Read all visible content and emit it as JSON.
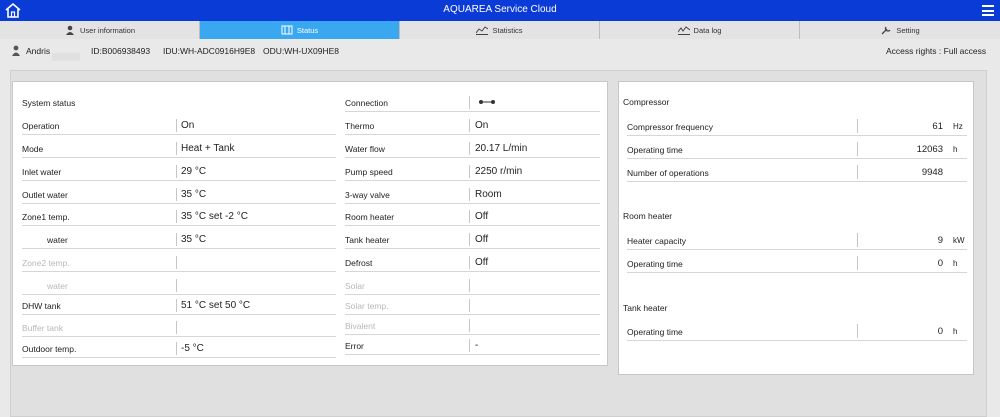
{
  "app": {
    "title": "AQUAREA Service Cloud"
  },
  "tabs": [
    {
      "label": "User information",
      "icon": "user-icon"
    },
    {
      "label": "Status",
      "icon": "status-icon"
    },
    {
      "label": "Statistics",
      "icon": "statistics-icon"
    },
    {
      "label": "Data log",
      "icon": "data-log-icon"
    },
    {
      "label": "Setting",
      "icon": "wrench-icon"
    }
  ],
  "active_tab": "Status",
  "user": {
    "name": "Andris",
    "id": "ID:B006938493",
    "idu": "IDU:WH-ADC0916H9E8",
    "odu": "ODU:WH-UX09HE8",
    "access": "Access rights : Full access"
  },
  "left": {
    "header": "System status",
    "rows": [
      {
        "label": "Operation",
        "value": "On"
      },
      {
        "label": "Mode",
        "value": "Heat + Tank"
      },
      {
        "label": "Inlet water",
        "value": "29 °C"
      },
      {
        "label": "Outlet water",
        "value": "35 °C"
      },
      {
        "label": "Zone1 temp.",
        "value": "35 °C   set -2 °C"
      },
      {
        "label": "water",
        "value": "35 °C"
      },
      {
        "label": "Zone2 temp.",
        "value": ""
      },
      {
        "label": "water",
        "value": ""
      },
      {
        "label": "DHW tank",
        "value": "51 °C   set 50 °C"
      },
      {
        "label": "Buffer tank",
        "value": ""
      },
      {
        "label": "Outdoor temp.",
        "value": "-5 °C"
      }
    ]
  },
  "middle": {
    "rows": [
      {
        "label": "Connection",
        "value": ""
      },
      {
        "label": "Thermo",
        "value": "On"
      },
      {
        "label": "Water flow",
        "value": "20.17 L/min"
      },
      {
        "label": "Pump speed",
        "value": "2250 r/min"
      },
      {
        "label": "3-way valve",
        "value": "Room"
      },
      {
        "label": "Room heater",
        "value": "Off"
      },
      {
        "label": "Tank heater",
        "value": "Off"
      },
      {
        "label": "Defrost",
        "value": "Off"
      },
      {
        "label": "Solar",
        "value": ""
      },
      {
        "label": "Solar temp.",
        "value": ""
      },
      {
        "label": "Bivalent",
        "value": ""
      },
      {
        "label": "Error",
        "value": "-"
      }
    ]
  },
  "right": {
    "compressor": {
      "header": "Compressor",
      "rows": [
        {
          "label": "Compressor frequency",
          "value": "61",
          "unit": "Hz"
        },
        {
          "label": "Operating time",
          "value": "12063",
          "unit": "h"
        },
        {
          "label": "Number of operations",
          "value": "9948",
          "unit": ""
        }
      ]
    },
    "room_heater": {
      "header": "Room heater",
      "rows": [
        {
          "label": "Heater capacity",
          "value": "9",
          "unit": "kW"
        },
        {
          "label": "Operating time",
          "value": "0",
          "unit": "h"
        }
      ]
    },
    "tank_heater": {
      "header": "Tank heater",
      "rows": [
        {
          "label": "Operating time",
          "value": "0",
          "unit": "h"
        }
      ]
    }
  },
  "colors": {
    "header_bar": "#0b3bd6",
    "active_tab": "#3aa8f0"
  }
}
